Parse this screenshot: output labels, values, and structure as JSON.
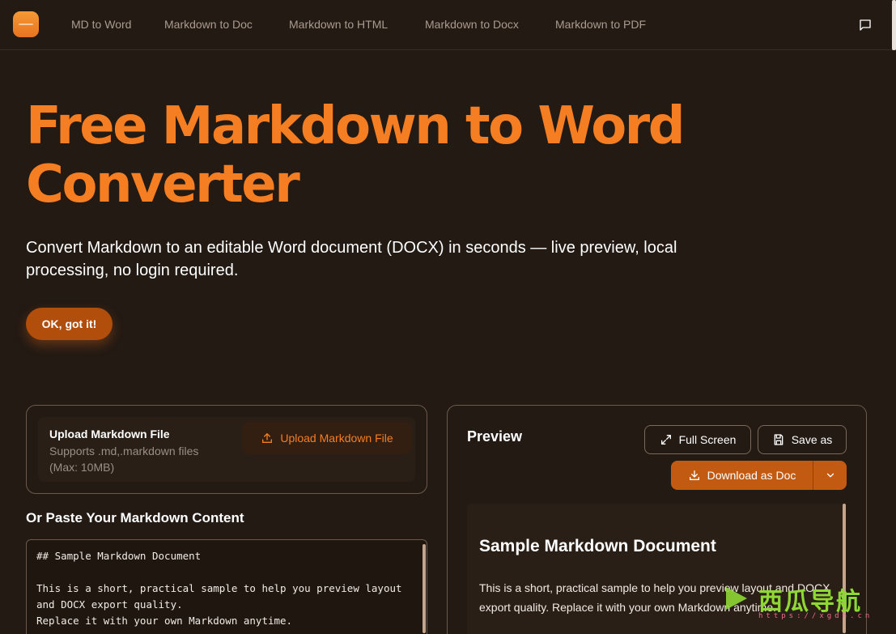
{
  "nav": {
    "links": [
      "MD to Word",
      "Markdown to Doc",
      "Markdown to HTML",
      "Markdown to Docx",
      "Markdown to PDF"
    ]
  },
  "hero": {
    "title_line1": "Free Markdown to Word",
    "title_line2": "Converter",
    "subtitle": "Convert Markdown to an editable Word document (DOCX) in seconds — live preview, local processing, no login required.",
    "ok_button": "OK, got it!"
  },
  "upload": {
    "title": "Upload Markdown File",
    "hint": "Supports .md,.markdown files (Max: 10MB)",
    "button": "Upload Markdown File"
  },
  "paste": {
    "title": "Or Paste Your Markdown Content",
    "content": "## Sample Markdown Document\n\nThis is a short, practical sample to help you preview layout\nand DOCX export quality.\nReplace it with your own Markdown anytime."
  },
  "preview": {
    "title": "Preview",
    "fullscreen_button": "Full Screen",
    "saveas_button": "Save as",
    "download_button": "Download as Doc",
    "doc_heading": "Sample Markdown Document",
    "doc_paragraph": "This is a short, practical sample to help you preview layout and DOCX export quality. Replace it with your own Markdown anytime."
  },
  "watermark": {
    "text": "西瓜导航",
    "url": "https://xgdh.cn"
  },
  "colors": {
    "background": "#231a14",
    "accent": "#f57e22",
    "button_fill": "#c25a12"
  }
}
